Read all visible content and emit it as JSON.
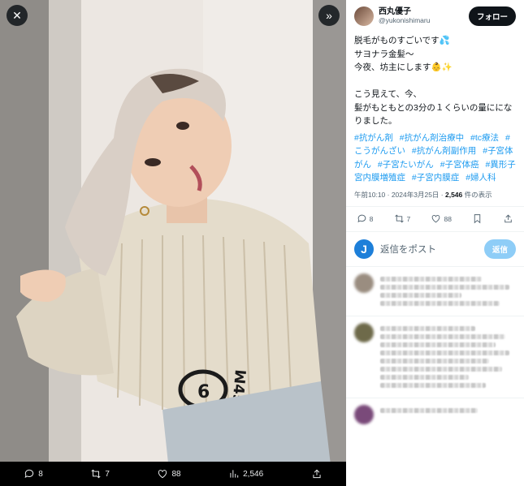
{
  "media": {
    "close_icon": "close-icon",
    "next_icon": "double-chevron-right-icon",
    "stats": {
      "replies": "8",
      "reposts": "7",
      "likes": "88",
      "views": "2,546"
    }
  },
  "tweet": {
    "display_name": "西丸優子",
    "handle": "@yukonishimaru",
    "follow_label": "フォロー",
    "body": "脱毛がものすごいです💦\nサヨナラ金髪～\n今夜、坊主にします👶✨\n\nこう見えて、今、\n髪がもともとの3分の１くらいの量にになりました。",
    "hashtags": [
      "#抗がん剤",
      "#抗がん剤治療中",
      "#tc療法",
      "#こうがんざい",
      "#抗がん剤副作用",
      "#子宮体がん",
      "#子宮たいがん",
      "#子宮体癌",
      "#異形子宮内膜増殖症",
      "#子宮内膜症",
      "#婦人科"
    ],
    "time": "午前10:10 · 2024年3月25日 · ",
    "views_count": "2,546",
    "views_label": " 件の表示",
    "replies": "8",
    "reposts": "7",
    "likes": "88"
  },
  "reply_box": {
    "avatar_letter": "J",
    "placeholder": "返信をポスト",
    "button_label": "返信"
  },
  "colors": {
    "accent": "#1d9bf0",
    "text": "#0f1419",
    "muted": "#536471"
  }
}
